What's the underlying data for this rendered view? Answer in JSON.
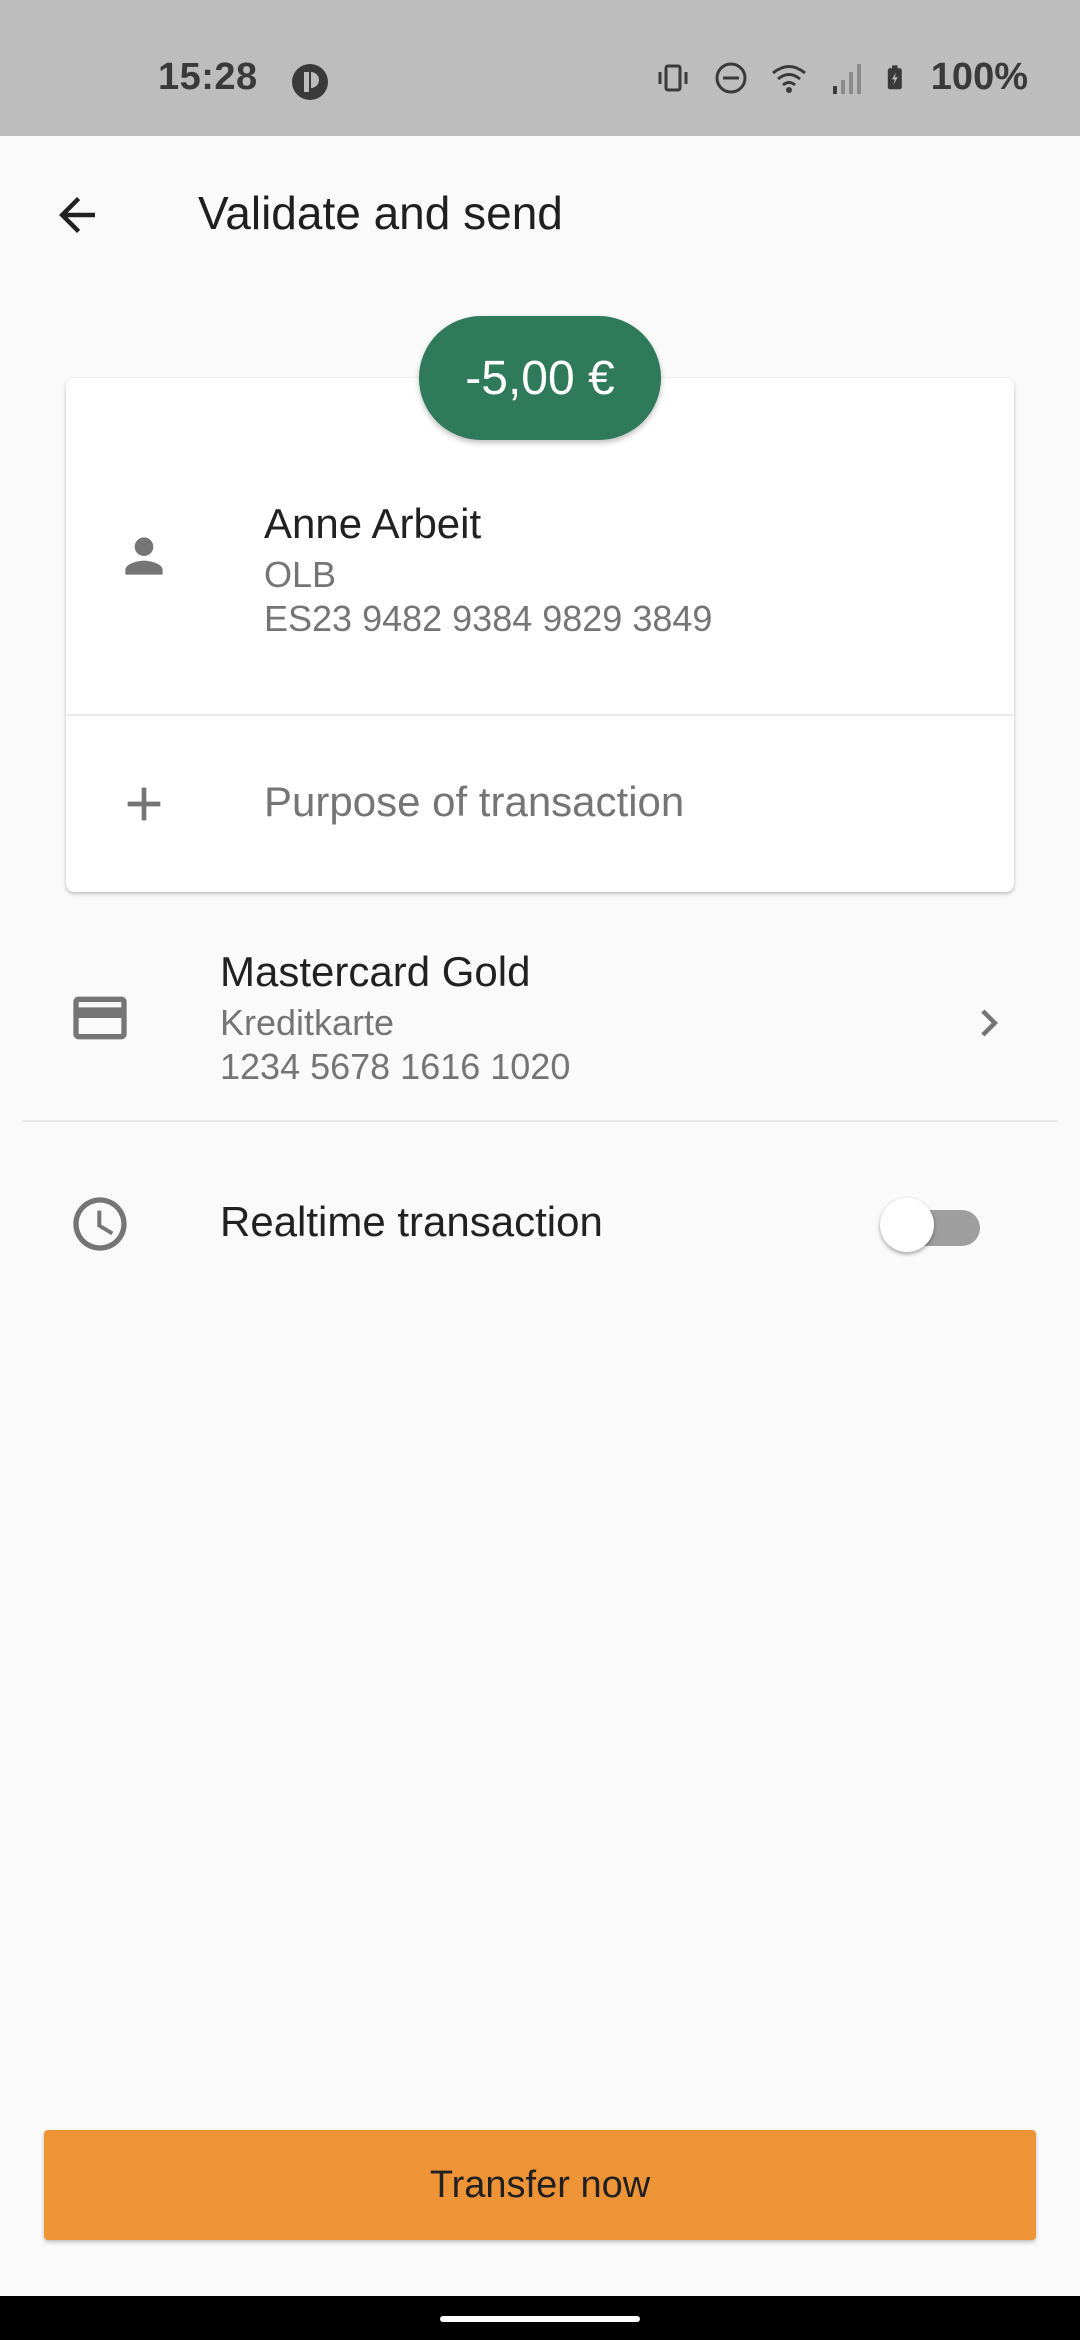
{
  "status_bar": {
    "time": "15:28",
    "battery": "100%",
    "icons": [
      "app-notification-icon",
      "vibrate-icon",
      "dnd-icon",
      "wifi-icon",
      "signal-icon",
      "battery-charging-icon"
    ]
  },
  "app_bar": {
    "back_icon": "arrow-back-icon",
    "title": "Validate and send"
  },
  "transfer": {
    "amount": "-5,00 €",
    "amount_color": "#2f7a5a"
  },
  "recipient": {
    "icon": "person-icon",
    "name": "Anne Arbeit",
    "bank": "OLB",
    "iban": "ES23 9482 9384 9829 3849"
  },
  "purpose": {
    "icon": "plus-icon",
    "placeholder": "Purpose of transaction"
  },
  "account": {
    "icon": "credit-card-icon",
    "name": "Mastercard Gold",
    "type": "Kreditkarte",
    "number": "1234 5678 1616 1020",
    "chevron_icon": "chevron-right-icon"
  },
  "realtime": {
    "icon": "clock-icon",
    "label": "Realtime transaction",
    "enabled": false
  },
  "actions": {
    "transfer_label": "Transfer now",
    "transfer_color": "#ee9437"
  }
}
